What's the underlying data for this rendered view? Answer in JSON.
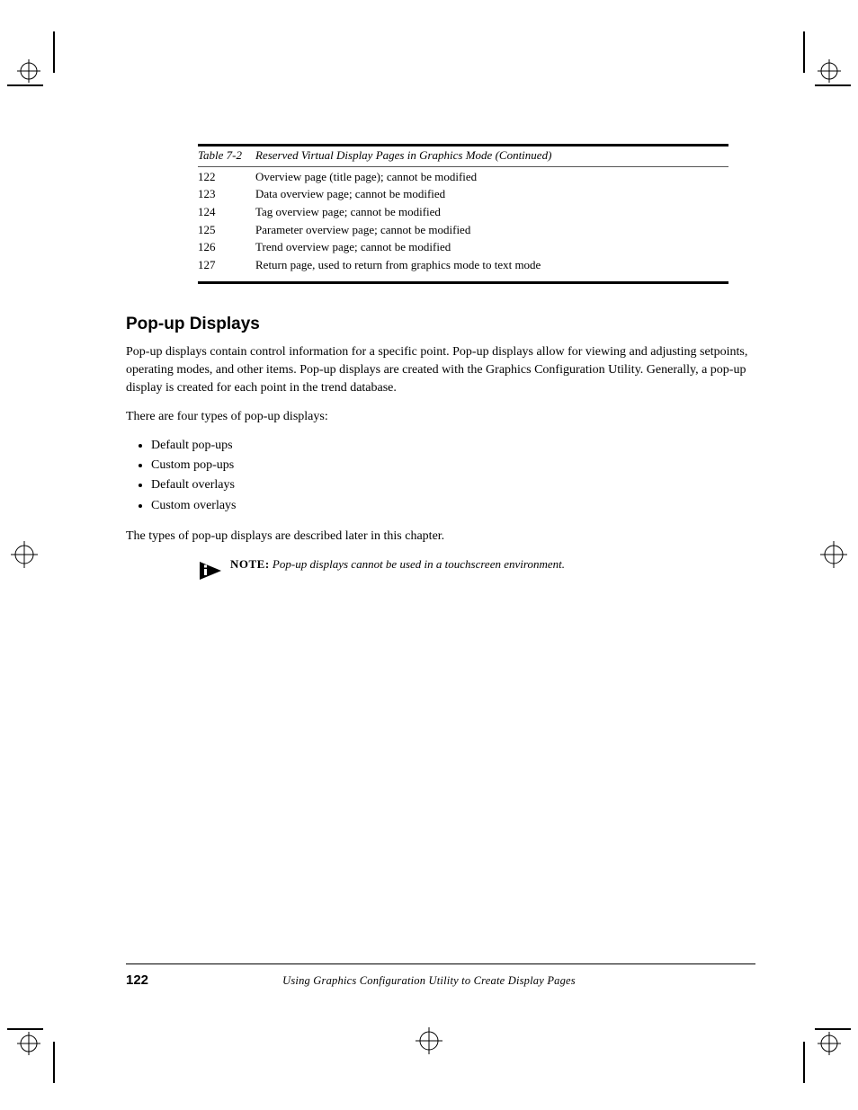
{
  "table": {
    "caption_a": "Table 7-2",
    "caption_b": "Reserved Virtual Display Pages in Graphics Mode (Continued)",
    "rows": [
      {
        "page": "122",
        "func": "Overview page (title page); cannot be modified"
      },
      {
        "page": "123",
        "func": "Data overview page; cannot be modified"
      },
      {
        "page": "124",
        "func": "Tag overview page; cannot be modified"
      },
      {
        "page": "125",
        "func": "Parameter overview page; cannot be modified"
      },
      {
        "page": "126",
        "func": "Trend overview page; cannot be modified"
      },
      {
        "page": "127",
        "func": "Return page, used to return from graphics mode to text mode"
      }
    ]
  },
  "section": {
    "title": "Pop-up Displays",
    "p1": "Pop-up displays contain control information for a specific point. Pop-up displays allow for viewing and adjusting setpoints, operating modes, and other items. Pop-up displays are created with the Graphics Configuration Utility. Generally, a pop-up display is created for each point in the trend database.",
    "p2": "There are four types of pop-up displays:",
    "bullets": [
      "Default pop-ups",
      "Custom pop-ups",
      "Default overlays",
      "Custom overlays"
    ],
    "p3": "The types of pop-up displays are described later in this chapter."
  },
  "note": {
    "label": "NOTE:",
    "text": "Pop-up displays cannot be used in a touchscreen environment."
  },
  "footer": {
    "page_number": "122",
    "text": "Using Graphics Configuration Utility to Create Display Pages"
  }
}
